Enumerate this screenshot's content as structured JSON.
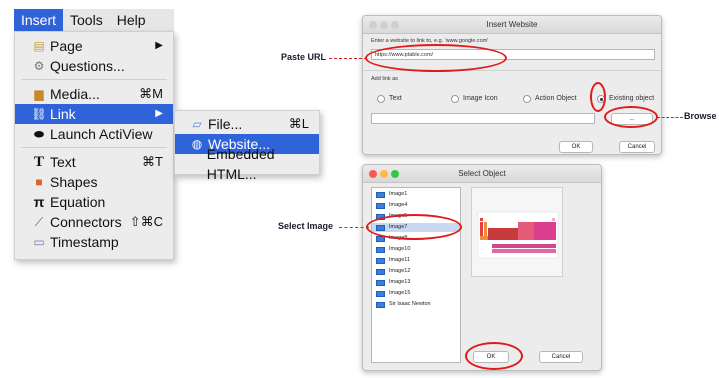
{
  "menubar": {
    "items": [
      "Insert",
      "Tools",
      "Help"
    ]
  },
  "insert_menu": {
    "items": [
      {
        "label": "Page",
        "icon": "page-icon",
        "shortcut": "▶"
      },
      {
        "label": "Questions...",
        "icon": "questions-icon",
        "shortcut": ""
      },
      {
        "label": "Media...",
        "icon": "media-icon",
        "shortcut": "⌘M"
      },
      {
        "label": "Link",
        "icon": "link-icon",
        "shortcut": "▶"
      },
      {
        "label": "Launch ActiView",
        "icon": "actiview-icon",
        "shortcut": ""
      },
      {
        "label": "Text",
        "icon": "text-icon",
        "shortcut": "⌘T"
      },
      {
        "label": "Shapes",
        "icon": "shapes-icon",
        "shortcut": ""
      },
      {
        "label": "Equation",
        "icon": "equation-icon",
        "shortcut": ""
      },
      {
        "label": "Connectors",
        "icon": "connectors-icon",
        "shortcut": "⇧⌘C"
      },
      {
        "label": "Timestamp",
        "icon": "timestamp-icon",
        "shortcut": ""
      }
    ]
  },
  "link_submenu": {
    "items": [
      {
        "label": "File...",
        "icon": "file-icon",
        "shortcut": "⌘L"
      },
      {
        "label": "Website...",
        "icon": "website-icon",
        "shortcut": ""
      },
      {
        "label": "Embedded HTML...",
        "icon": "",
        "shortcut": ""
      }
    ]
  },
  "insert_website": {
    "title": "Insert Website",
    "prompt": "Enter a website to link to, e.g. 'www.google.com'",
    "url_value": "https://www.ptable.com/",
    "link_as_label": "Add link as",
    "options": [
      "Text",
      "Image Icon",
      "Action Object",
      "Existing object"
    ],
    "selected_option": "Existing object",
    "browse_label": "...",
    "ok": "OK",
    "cancel": "Cancel"
  },
  "select_object": {
    "title": "Select Object",
    "items": [
      "Image1",
      "Image4",
      "Image5",
      "Image7",
      "Image8",
      "Image10",
      "Image11",
      "Image12",
      "Image13",
      "Image15",
      "Sir Isaac Newton"
    ],
    "selected_item": "Image7",
    "ok": "OK",
    "cancel": "Cancel"
  },
  "annotations": {
    "paste_url": "Paste URL",
    "browse": "Browse",
    "select_image": "Select Image"
  },
  "colors": {
    "highlight": "#2f63d9",
    "annotation_red": "#e01b1b"
  }
}
